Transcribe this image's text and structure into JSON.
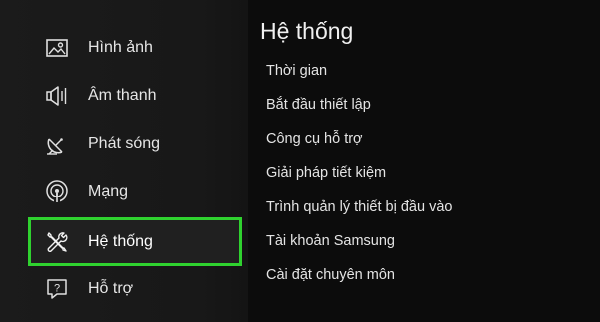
{
  "sidebar": {
    "items": [
      {
        "label": "Hình ảnh",
        "icon": "picture-icon"
      },
      {
        "label": "Âm thanh",
        "icon": "speaker-icon"
      },
      {
        "label": "Phát sóng",
        "icon": "satellite-dish-icon"
      },
      {
        "label": "Mạng",
        "icon": "network-icon"
      },
      {
        "label": "Hệ thống",
        "icon": "tools-icon",
        "selected": true
      },
      {
        "label": "Hỗ trợ",
        "icon": "help-icon"
      }
    ],
    "selected_border_color": "#2fd22f"
  },
  "content": {
    "title": "Hệ thống",
    "items": [
      "Thời gian",
      "Bắt đầu thiết lập",
      "Công cụ hỗ trợ",
      "Giải pháp tiết kiệm",
      "Trình quản lý thiết bị đầu vào",
      "Tài khoản Samsung",
      "Cài đặt chuyên môn"
    ]
  }
}
